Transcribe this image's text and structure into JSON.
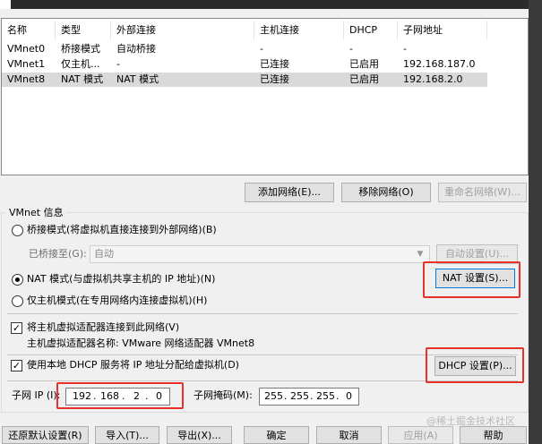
{
  "table": {
    "columns": [
      "名称",
      "类型",
      "外部连接",
      "主机连接",
      "DHCP",
      "子网地址"
    ],
    "rows": [
      {
        "name": "VMnet0",
        "type": "桥接模式",
        "external": "自动桥接",
        "host": "-",
        "dhcp": "-",
        "subnet": "-",
        "selected": false
      },
      {
        "name": "VMnet1",
        "type": "仅主机...",
        "external": "-",
        "host": "已连接",
        "dhcp": "已启用",
        "subnet": "192.168.187.0",
        "selected": false
      },
      {
        "name": "VMnet8",
        "type": "NAT 模式",
        "external": "NAT 模式",
        "host": "已连接",
        "dhcp": "已启用",
        "subnet": "192.168.2.0",
        "selected": true
      }
    ]
  },
  "list_buttons": {
    "add": "添加网络(E)...",
    "remove": "移除网络(O)",
    "rename": "重命名网络(W)..."
  },
  "vmnet_info": {
    "title": "VMnet 信息",
    "bridged_label": "桥接模式(将虚拟机直接连接到外部网络)(B)",
    "bridged_to_label": "已桥接至(G):",
    "bridged_to_value": "自动",
    "auto_settings": "自动设置(U)...",
    "nat_label": "NAT 模式(与虚拟机共享主机的 IP 地址)(N)",
    "nat_settings": "NAT 设置(S)...",
    "hostonly_label": "仅主机模式(在专用网络内连接虚拟机)(H)",
    "connect_adapter_label": "将主机虚拟适配器连接到此网络(V)",
    "adapter_name_label": "主机虚拟适配器名称: VMware 网络适配器 VMnet8",
    "use_dhcp_label": "使用本地 DHCP 服务将 IP 地址分配给虚拟机(D)",
    "dhcp_settings": "DHCP 设置(P)...",
    "subnet_ip_label": "子网 IP (I):",
    "subnet_ip": [
      "192",
      "168",
      "2",
      "0"
    ],
    "subnet_mask_label": "子网掩码(M):",
    "subnet_mask": [
      "255",
      "255",
      "255",
      "0"
    ],
    "ip_dot": "."
  },
  "footer_buttons": {
    "restore": "还原默认设置(R)",
    "import": "导入(T)...",
    "export": "导出(X)...",
    "ok": "确定",
    "cancel": "取消",
    "apply": "应用(A)",
    "help": "帮助"
  },
  "watermark": "@稀土掘金技术社区",
  "colors": {
    "highlight": "#e8312a",
    "selected_row": "#d9d9d9",
    "focus": "#0078d7"
  }
}
